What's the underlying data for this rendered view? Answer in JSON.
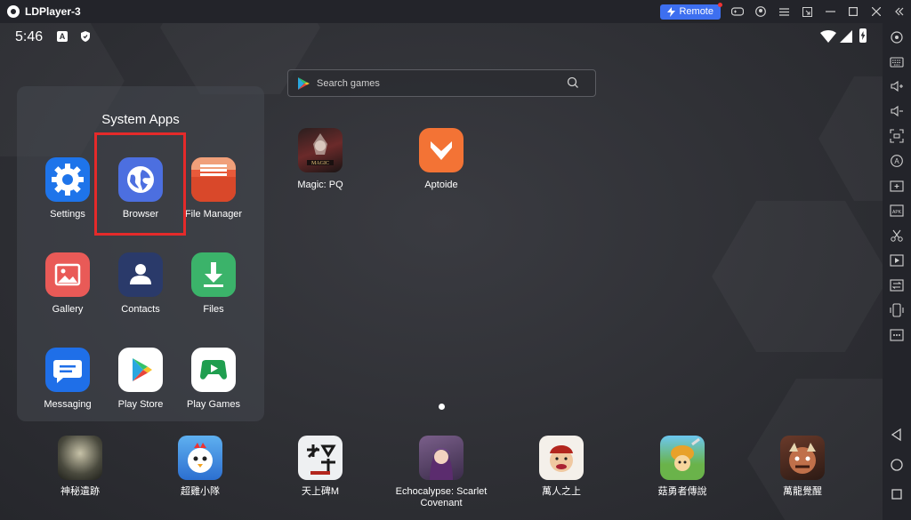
{
  "window": {
    "title": "LDPlayer-3",
    "remote_label": "Remote"
  },
  "status_bar": {
    "time": "5:46"
  },
  "search": {
    "placeholder": "Search games"
  },
  "folder": {
    "title": "System Apps",
    "apps": [
      {
        "label": "Settings",
        "icon": "gear-icon"
      },
      {
        "label": "Browser",
        "icon": "globe-icon"
      },
      {
        "label": "File Manager",
        "icon": "folder-icon"
      },
      {
        "label": "Gallery",
        "icon": "image-icon"
      },
      {
        "label": "Contacts",
        "icon": "person-icon"
      },
      {
        "label": "Files",
        "icon": "download-icon"
      },
      {
        "label": "Messaging",
        "icon": "message-icon"
      },
      {
        "label": "Play Store",
        "icon": "play-store-icon"
      },
      {
        "label": "Play Games",
        "icon": "play-games-icon"
      }
    ]
  },
  "desktop_apps": [
    {
      "label": "Magic: PQ"
    },
    {
      "label": "Aptoide"
    }
  ],
  "dock": [
    {
      "label": "神秘遺跡"
    },
    {
      "label": "超雞小隊"
    },
    {
      "label": "天上碑M"
    },
    {
      "label": "Echocalypse: Scarlet Covenant"
    },
    {
      "label": "萬人之上"
    },
    {
      "label": "菇勇者傳說"
    },
    {
      "label": "萬龍覺醒"
    }
  ],
  "colors": {
    "accent": "#3d6ff0",
    "highlight": "#e52a2a",
    "background": "#2f3035"
  }
}
